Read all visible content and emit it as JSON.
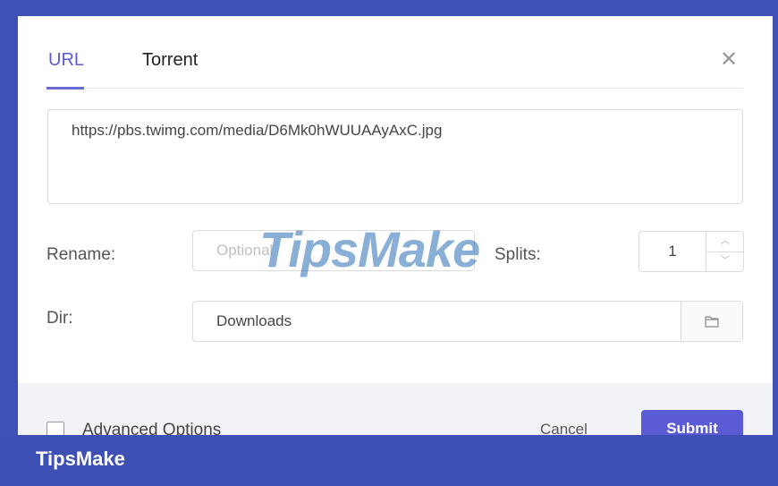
{
  "tabs": [
    {
      "label": "URL",
      "active": true
    },
    {
      "label": "Torrent",
      "active": false
    }
  ],
  "close_icon": "close-icon",
  "url_textarea": {
    "value": "https://pbs.twimg.com/media/D6Mk0hWUUAAyAxC.jpg"
  },
  "rename": {
    "label": "Rename:",
    "placeholder": "Optional"
  },
  "splits": {
    "label": "Splits:",
    "value": "1"
  },
  "dir": {
    "label": "Dir:",
    "value": "Downloads",
    "button_icon": "folder-icon"
  },
  "footer": {
    "advanced_label": "Advanced Options",
    "cancel_label": "Cancel",
    "submit_label": "Submit"
  },
  "watermark": "TipsMake",
  "brand": "TipsMake",
  "colors": {
    "accent": "#5b5bd6",
    "frame": "#4051b5"
  }
}
